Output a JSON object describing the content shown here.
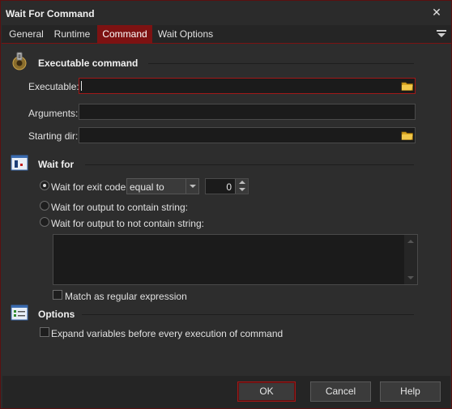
{
  "window": {
    "title": "Wait For Command"
  },
  "tabs": [
    {
      "label": "General"
    },
    {
      "label": "Runtime"
    },
    {
      "label": "Command"
    },
    {
      "label": "Wait Options"
    }
  ],
  "active_tab": "Command",
  "sections": {
    "executable": {
      "title": "Executable command"
    },
    "wait_for": {
      "title": "Wait for"
    },
    "options": {
      "title": "Options"
    }
  },
  "fields": {
    "executable": {
      "label": "Executable:",
      "value": ""
    },
    "arguments": {
      "label": "Arguments:",
      "value": ""
    },
    "starting_dir": {
      "label": "Starting dir:",
      "value": ""
    }
  },
  "wait": {
    "exit_code_label": "Wait for exit code",
    "comparison_value": "equal to",
    "exit_code_value": "0",
    "contain_label": "Wait for output to contain string:",
    "not_contain_label": "Wait for output to not contain string:",
    "selected": "exit_code",
    "string_value": "",
    "regex_label": "Match as regular expression",
    "regex_checked": false
  },
  "options": {
    "expand_label": "Expand variables before every execution of command",
    "expand_checked": false
  },
  "buttons": {
    "ok": "OK",
    "cancel": "Cancel",
    "help": "Help"
  },
  "colors": {
    "accent": "#7d1212",
    "background": "#2d2d2d",
    "field": "#1b1b1b"
  },
  "icons": {
    "executable_section": "executable-gear-icon",
    "wait_section": "wait-window-icon",
    "options_section": "options-list-icon",
    "browse": "folder-icon",
    "close": "close-icon",
    "tab_menu": "tab-menu-icon"
  }
}
